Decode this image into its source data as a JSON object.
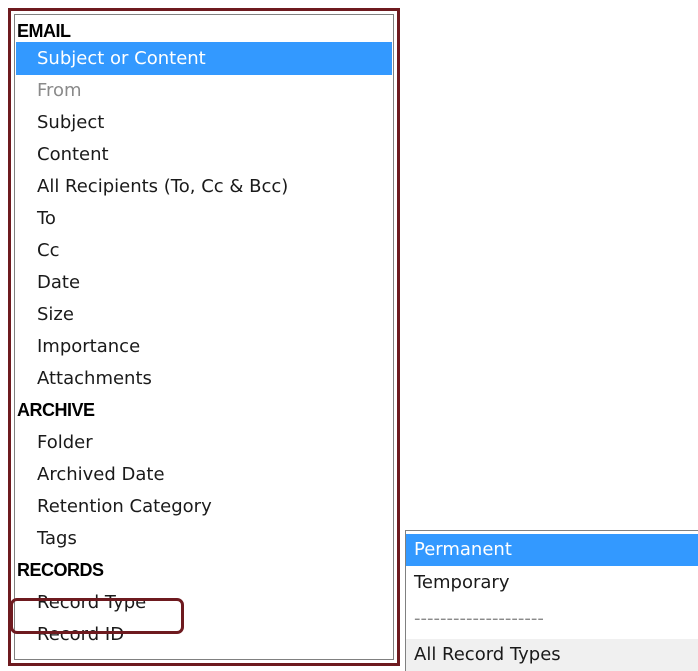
{
  "field_dropdown": {
    "sections": [
      {
        "header": "EMAIL",
        "items": [
          {
            "label": "Subject or Content",
            "state": "selected"
          },
          {
            "label": "From",
            "state": "disabled"
          },
          {
            "label": "Subject",
            "state": "normal"
          },
          {
            "label": "Content",
            "state": "normal"
          },
          {
            "label": "All Recipients (To, Cc & Bcc)",
            "state": "normal"
          },
          {
            "label": "To",
            "state": "normal"
          },
          {
            "label": "Cc",
            "state": "normal"
          },
          {
            "label": "Date",
            "state": "normal"
          },
          {
            "label": "Size",
            "state": "normal"
          },
          {
            "label": "Importance",
            "state": "normal"
          },
          {
            "label": "Attachments",
            "state": "normal"
          }
        ]
      },
      {
        "header": "ARCHIVE",
        "items": [
          {
            "label": "Folder",
            "state": "normal"
          },
          {
            "label": "Archived Date",
            "state": "normal"
          },
          {
            "label": "Retention Category",
            "state": "normal"
          },
          {
            "label": "Tags",
            "state": "normal"
          }
        ]
      },
      {
        "header": "RECORDS",
        "items": [
          {
            "label": "Record Type",
            "state": "highlighted"
          },
          {
            "label": "Record ID",
            "state": "normal"
          }
        ]
      }
    ]
  },
  "record_type_dropdown": {
    "options": [
      {
        "label": "Permanent",
        "state": "selected"
      },
      {
        "label": "Temporary",
        "state": "normal"
      },
      {
        "label": "--------------------",
        "state": "separator"
      },
      {
        "label": "All Record Types",
        "state": "footer"
      }
    ]
  },
  "colors": {
    "selection": "#3399ff",
    "frame": "#6e1a1f",
    "disabled_text": "#8a8a8a"
  }
}
